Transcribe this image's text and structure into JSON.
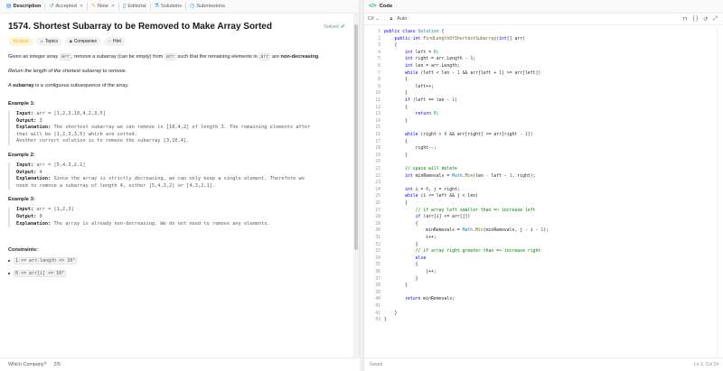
{
  "tabs": [
    {
      "label": "Description",
      "icon": "doc-icon"
    },
    {
      "label": "Accepted",
      "icon": "history-icon"
    },
    {
      "label": "Note",
      "icon": "note-icon"
    },
    {
      "label": "Editorial",
      "icon": "book-icon"
    },
    {
      "label": "Solutions",
      "icon": "flask-icon"
    },
    {
      "label": "Submissions",
      "icon": "clock-icon"
    }
  ],
  "problem": {
    "title": "1574. Shortest Subarray to be Removed to Make Array Sorted",
    "solved": "Solved",
    "difficulty": "Medium",
    "chips": [
      "Topics",
      "Companies",
      "Hint"
    ],
    "desc1_a": "Given an integer array ",
    "desc1_code1": "arr",
    "desc1_b": ", remove a subarray (can be empty) from ",
    "desc1_code2": "arr",
    "desc1_c": " such that the remaining elements in ",
    "desc1_code3": "arr",
    "desc1_d": " are ",
    "desc1_bold": "non-decreasing",
    "desc1_e": ".",
    "desc2": "Return the length of the shortest subarray to remove.",
    "desc3_a": "A ",
    "desc3_bold": "subarray",
    "desc3_b": " is a contiguous subsequence of the array."
  },
  "examples": [
    {
      "title": "Example 1:",
      "input": "arr = [1,2,3,10,4,2,3,5]",
      "output": "3",
      "explanation": [
        "The shortest subarray we can remove is [10,4,2] of length 3. The remaining elements after",
        "that will be [1,2,3,3,5] which are sorted.",
        "Another correct solution is to remove the subarray [3,10,4]."
      ]
    },
    {
      "title": "Example 2:",
      "input": "arr = [5,4,3,2,1]",
      "output": "4",
      "explanation": [
        "Since the array is strictly decreasing, we can only keep a single element. Therefore we",
        "need to remove a subarray of length 4, either [5,4,3,2] or [4,3,2,1]."
      ]
    },
    {
      "title": "Example 3:",
      "input": "arr = [1,2,3]",
      "output": "0",
      "explanation": [
        "The array is already non-decreasing. We do not need to remove any elements."
      ]
    }
  ],
  "labels": {
    "input": "Input:",
    "output": "Output:",
    "explanation": "Explanation:"
  },
  "constraints": {
    "title": "Constraints:",
    "items": [
      "1 <= arr.length <= 10⁵",
      "0 <= arr[i] <= 10⁹"
    ]
  },
  "bottom": {
    "which_company": "Which Company?",
    "page": "2/5"
  },
  "code_panel": {
    "header": "Code",
    "language": "C#",
    "mode": "Auto",
    "status_left": "Saved",
    "status_right": "Ln 1, Col 24"
  },
  "code_lines": [
    "public class Solution {",
    "    public int FindLengthOfShortestSubarray(int[] arr)",
    "    {",
    "        int left = 0;",
    "        int right = arr.Length - 1;",
    "        int len = arr.Length;",
    "        while (left < len - 1 && arr[left + 1] >= arr[left])",
    "        {",
    "            left++;",
    "        }",
    "        if (left == len - 1)",
    "        {",
    "            return 0;",
    "        }",
    "",
    "        while (right > 0 && arr[right] >= arr[right - 1])",
    "        {",
    "            right--;",
    "        }",
    "",
    "        // space will delete",
    "        int minRemovals = Math.Min(len - left - 1, right);",
    "",
    "        int i = 0, j = right;",
    "        while (i <= left && j < len)",
    "        {",
    "            // if array left smaller than => increase left",
    "            if (arr[i] <= arr[j])",
    "            {",
    "                minRemovals = Math.Min(minRemovals, j - i - 1);",
    "                i++;",
    "            }",
    "            // if array right greater than => increase right",
    "            else",
    "            {",
    "                j++;",
    "            }",
    "        }",
    "",
    "        return minRemovals;",
    "",
    "    }",
    "}"
  ]
}
